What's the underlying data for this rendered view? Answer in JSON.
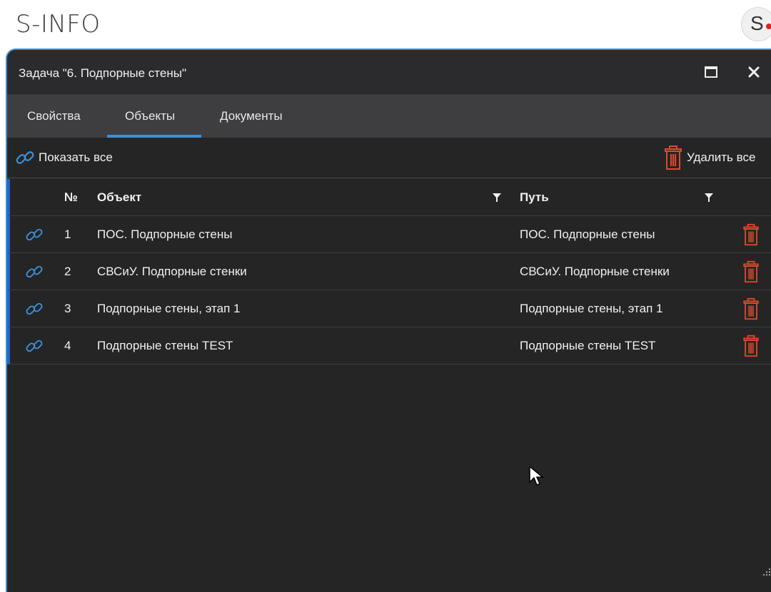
{
  "app": {
    "title": "S-INFO",
    "avatar_letter": "S"
  },
  "window": {
    "title": "Задача \"6. Подпорные стены\"",
    "maximize_icon": "maximize-icon",
    "close_icon": "close-icon"
  },
  "tabs": [
    {
      "label": "Свойства",
      "active": false
    },
    {
      "label": "Объекты",
      "active": true
    },
    {
      "label": "Документы",
      "active": false
    }
  ],
  "toolbar": {
    "show_all_label": "Показать все",
    "delete_all_label": "Удалить все"
  },
  "table": {
    "columns": {
      "num": "№",
      "object": "Объект",
      "path": "Путь"
    },
    "rows": [
      {
        "num": "1",
        "object": "ПОС. Подпорные стены",
        "path": "ПОС. Подпорные стены"
      },
      {
        "num": "2",
        "object": "СВСиУ. Подпорные стенки",
        "path": "СВСиУ. Подпорные стенки"
      },
      {
        "num": "3",
        "object": "Подпорные стены, этап 1",
        "path": "Подпорные стены, этап 1"
      },
      {
        "num": "4",
        "object": "Подпорные стены TEST",
        "path": "Подпорные стены TEST"
      }
    ]
  },
  "colors": {
    "accent": "#3c8fd8",
    "row_marker": "#2266c4",
    "delete": "#e04a2a",
    "link": "#3c8fd8"
  }
}
